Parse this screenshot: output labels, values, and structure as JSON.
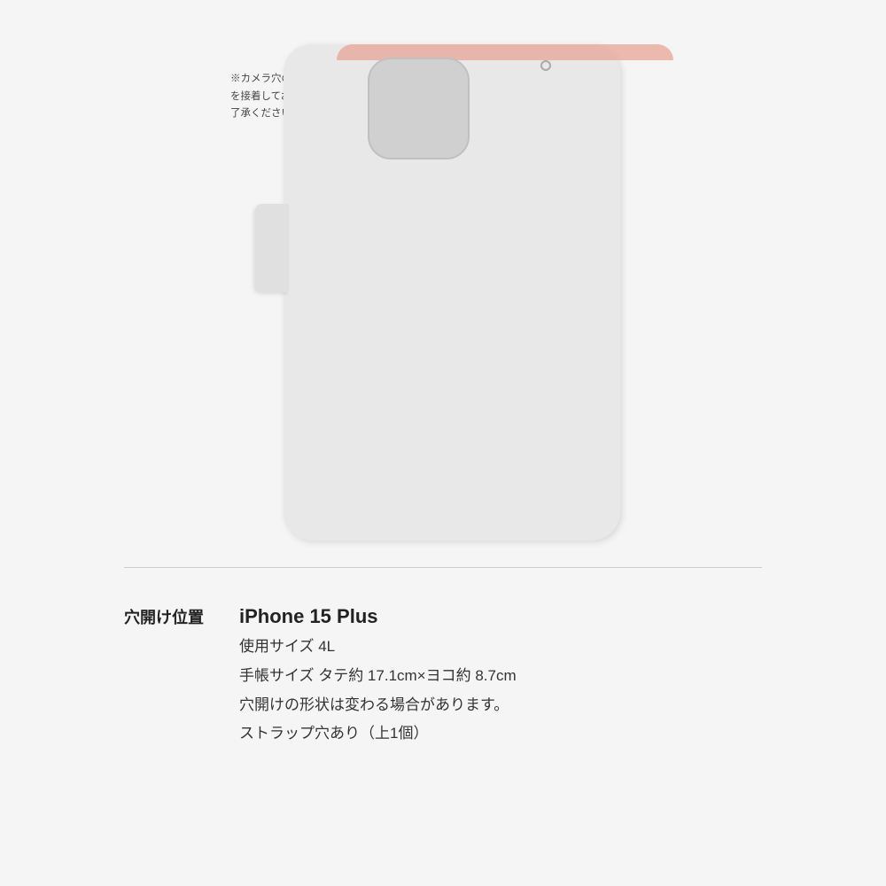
{
  "page": {
    "background_color": "#f5f5f5"
  },
  "note": {
    "text": "※カメラ穴の横ならびに上部はケースを接着しておりません。あらかじめご了承ください。"
  },
  "case": {
    "fold_color": "#e8a090",
    "body_color": "#e8e8e8",
    "camera_cutout_color": "#d0d0d0",
    "strap_hole_present": true,
    "side_tab_present": true
  },
  "info": {
    "label": "穴開け位置",
    "device_name": "iPhone 15 Plus",
    "details": [
      "使用サイズ 4L",
      "手帳サイズ タテ約 17.1cm×ヨコ約 8.7cm",
      "穴開けの形状は変わる場合があります。",
      "ストラップ穴あり（上1個）"
    ]
  }
}
